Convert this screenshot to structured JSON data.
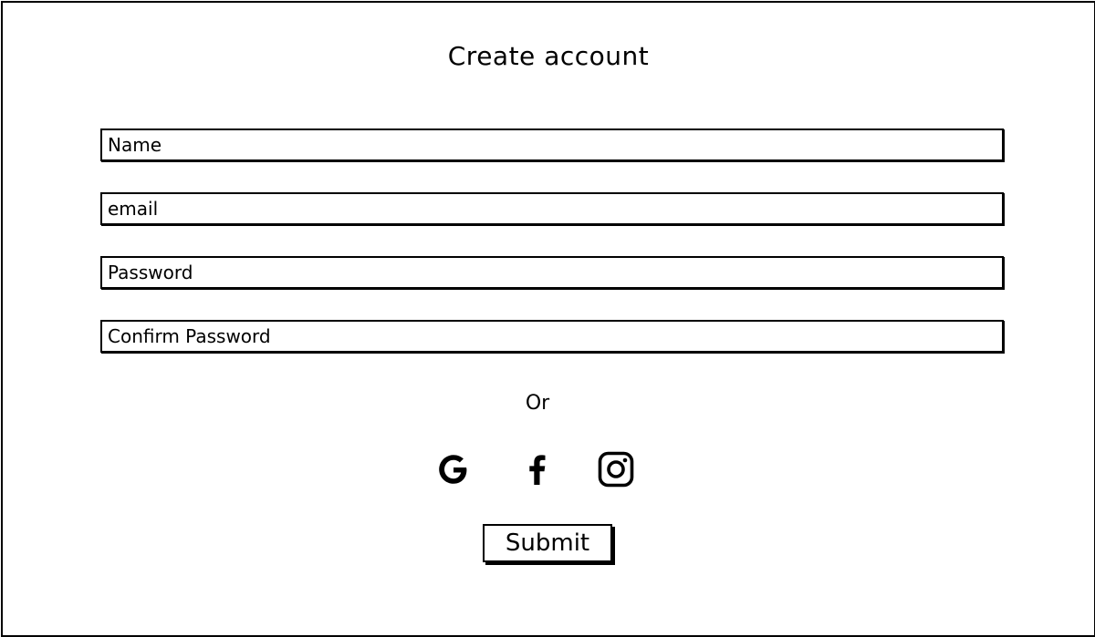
{
  "page": {
    "title": "Create account"
  },
  "form": {
    "name_placeholder": "Name",
    "email_placeholder": "email",
    "password_placeholder": "Password",
    "confirm_password_placeholder": "Confirm Password"
  },
  "divider_text": "Or",
  "social": {
    "icons": [
      "google-icon",
      "facebook-icon",
      "instagram-icon"
    ]
  },
  "submit_label": "Submit",
  "colors": {
    "ink": "#000000",
    "background": "#ffffff"
  }
}
